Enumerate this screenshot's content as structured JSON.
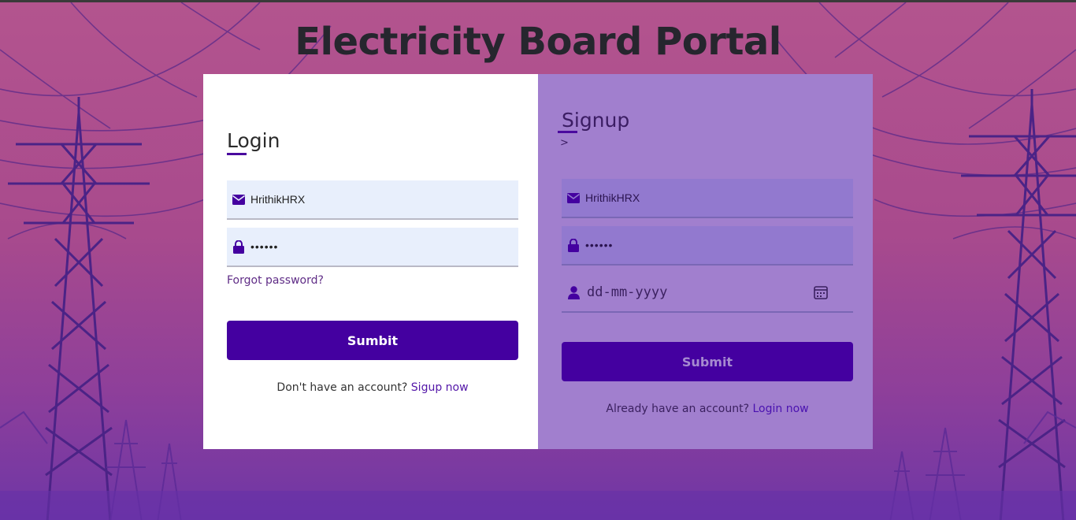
{
  "title": "Electricity Board Portal",
  "colors": {
    "accent": "#4400a0",
    "login_panel": "#ffffff",
    "signup_panel": "#a17fce",
    "background": "#b3548e"
  },
  "login": {
    "heading": "Login",
    "username_value": "HrithikHRX",
    "password_value": "••••••",
    "forgot_label": "Forgot password?",
    "submit_label": "Sumbit",
    "switch_prompt": "Don't have an account?",
    "switch_link": "Sigup now",
    "icons": {
      "username": "envelope-icon",
      "password": "lock-icon"
    }
  },
  "signup": {
    "heading": "Signup",
    "chevron": ">",
    "username_value": "HrithikHRX",
    "password_value": "••••••",
    "date_placeholder": "dd-mm-yyyy",
    "submit_label": "Submit",
    "switch_prompt": "Already have an account?",
    "switch_link": "Login now",
    "icons": {
      "username": "envelope-icon",
      "password": "lock-icon",
      "dob": "user-icon",
      "calendar": "calendar-icon"
    }
  }
}
